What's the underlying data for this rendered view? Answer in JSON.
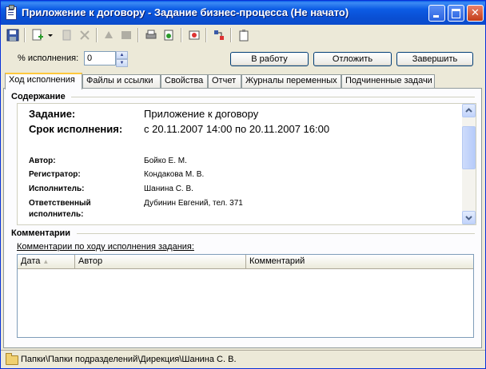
{
  "window": {
    "title": "Приложение к договору - Задание бизнес-процесса (Не начато)"
  },
  "toolbar": {
    "icons": [
      "save-icon",
      "add-icon",
      "dropdown-arrow-icon",
      "copy-icon",
      "delete-icon",
      "forward-icon",
      "reply-icon",
      "print-icon",
      "export-icon",
      "history-icon",
      "route-icon",
      "clipboard-icon"
    ]
  },
  "progress": {
    "label": "% исполнения:",
    "value": "0",
    "start_button": "В работу",
    "postpone_button": "Отложить",
    "complete_button": "Завершить"
  },
  "tabs": [
    {
      "label": "Ход исполнения",
      "active": true
    },
    {
      "label": "Файлы и ссылки"
    },
    {
      "label": "Свойства"
    },
    {
      "label": "Отчет"
    },
    {
      "label": "Журналы переменных"
    },
    {
      "label": "Подчиненные задачи"
    }
  ],
  "content": {
    "group_title": "Содержание",
    "task_label": "Задание:",
    "task_value": "Приложение к договору",
    "deadline_label": "Срок исполнения:",
    "deadline_value": "с 20.11.2007 14:00 по 20.11.2007 16:00",
    "author_label": "Автор:",
    "author_value": "Бойко Е. М.",
    "registrar_label": "Регистратор:",
    "registrar_value": "Кондакова М. В.",
    "executor_label": "Исполнитель:",
    "executor_value": "Шанина С. В.",
    "responsible_label_1": "Ответственный",
    "responsible_label_2": "исполнитель:",
    "responsible_value": "Дубинин Евгений, тел. 371"
  },
  "comments": {
    "group_title": "Комментарии",
    "caption": "Комментарии по ходу исполнения задания:",
    "columns": [
      "Дата",
      "Автор",
      "Комментарий"
    ],
    "rows": []
  },
  "status": {
    "path": "Папки\\Папки подразделений\\Дирекция\\Шанина С. В."
  },
  "colors": {
    "titlebar": "#0a5ee9",
    "window_bg": "#ece9d8",
    "active_tab_accent": "#ffc83c"
  }
}
